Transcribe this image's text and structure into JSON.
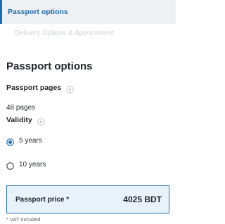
{
  "steps": {
    "active_label": "Passport options",
    "next_label": "Delivery Options & Appointment"
  },
  "section": {
    "title": "Passport options"
  },
  "passport_pages": {
    "label": "Passport pages",
    "value": "48 pages"
  },
  "validity": {
    "label": "Validity",
    "options": [
      {
        "label": "5 years",
        "selected": true
      },
      {
        "label": "10 years",
        "selected": false
      }
    ]
  },
  "price": {
    "label": "Passport price *",
    "value": "4025 BDT"
  },
  "vat_note": {
    "star": "*",
    "text": "VAT included"
  },
  "colors": {
    "accent": "#1b6fb3",
    "price_background": "#e8f2fb",
    "help_icon": "#c5c9ce"
  },
  "icons": {
    "help": "question-circle-icon",
    "radio_selected": "radio-checked-icon",
    "radio_unselected": "radio-unchecked-icon"
  }
}
